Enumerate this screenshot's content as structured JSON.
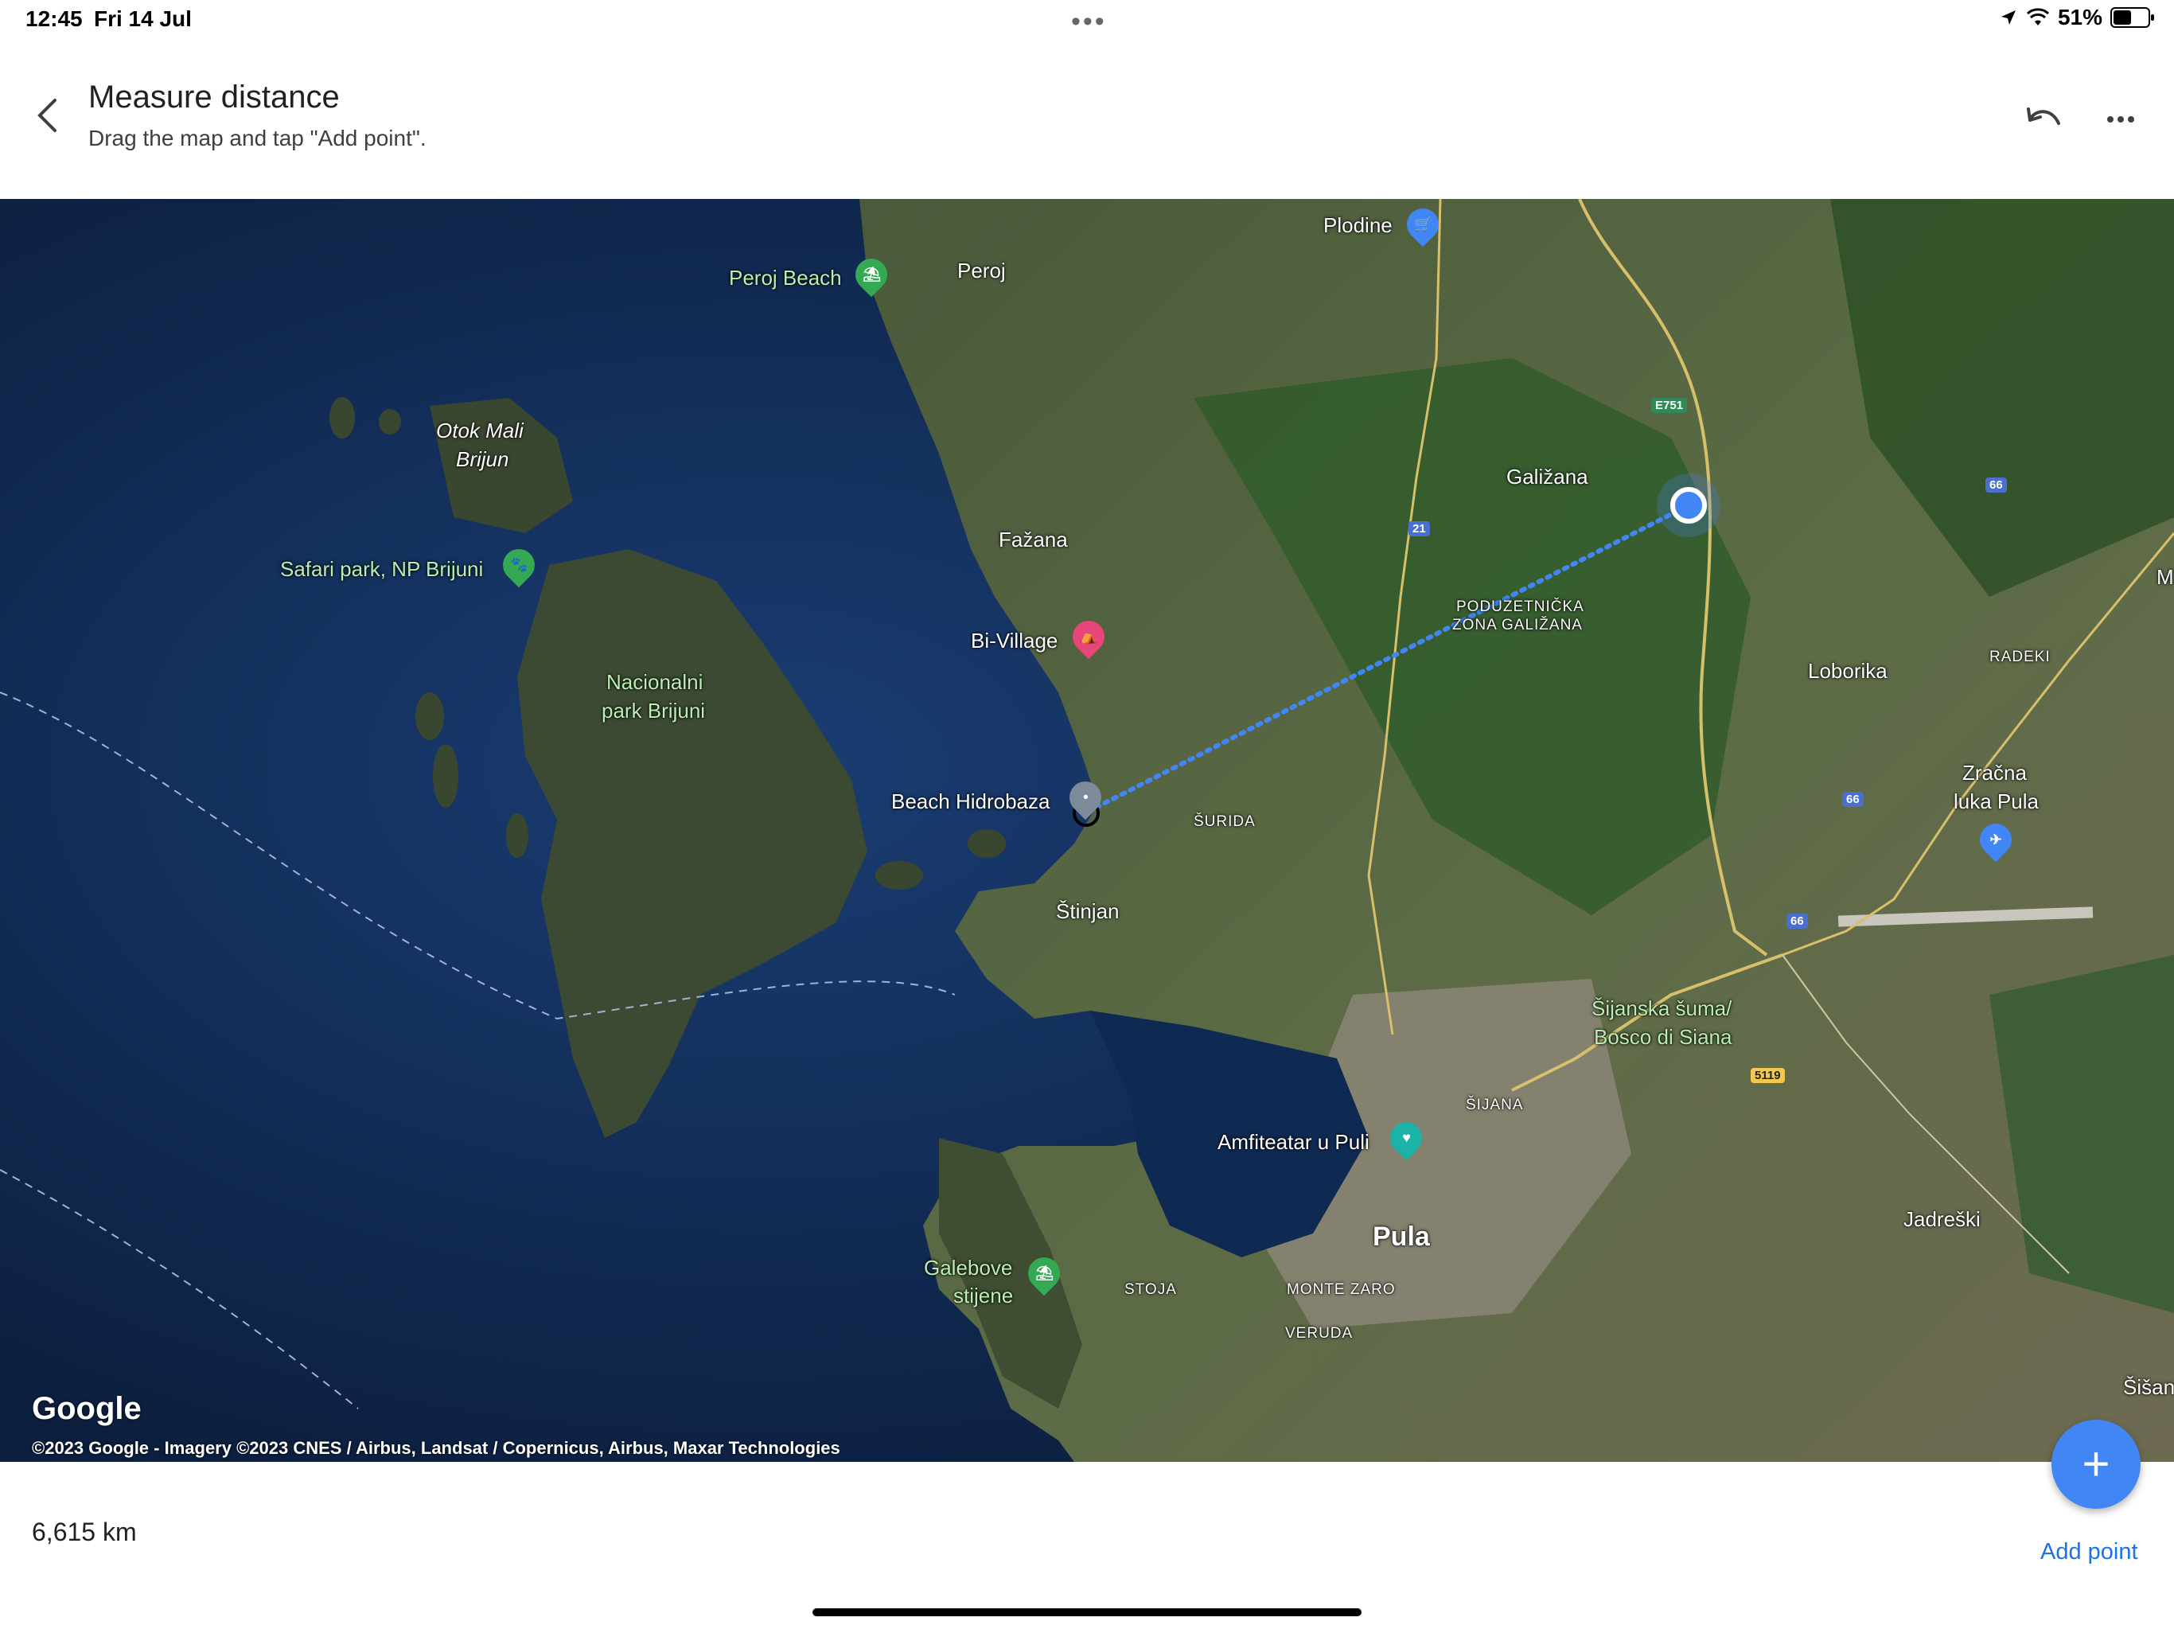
{
  "status_bar": {
    "time": "12:45",
    "date": "Fri 14 Jul",
    "battery": "51%"
  },
  "header": {
    "title": "Measure distance",
    "subtitle": "Drag the map and tap \"Add point\"."
  },
  "map": {
    "labels": {
      "plodine": "Plodine",
      "peroj": "Peroj",
      "peroj_beach": "Peroj Beach",
      "galizana": "Galižana",
      "otok_1": "Otok Mali",
      "otok_2": "Brijun",
      "fazana": "Fažana",
      "safari": "Safari park, NP Brijuni",
      "poduzet_1": "PODUZETNIČKA",
      "poduzet_2": "ZONA GALIŽANA",
      "bivillage": "Bi-Village",
      "loborika": "Loborika",
      "radeki": "RADEKI",
      "nacionalni_1": "Nacionalni",
      "nacionalni_2": "park Brijuni",
      "zracna_1": "Zračna",
      "zracna_2": "luka Pula",
      "hidrobaza": "Beach Hidrobaza",
      "surida": "ŠURIDA",
      "stinjan": "Štinjan",
      "sijanska_1": "Šijanska šuma/",
      "sijanska_2": "Bosco di Siana",
      "sijana": "ŠIJANA",
      "amfiteatar": "Amfiteatar u Puli",
      "pula": "Pula",
      "jadreski": "Jadreški",
      "galebove_1": "Galebove",
      "galebove_2": "stijene",
      "stoja": "STOJA",
      "monte_zaro": "MONTE ZARO",
      "veruda": "VERUDA",
      "sisan": "Šišan",
      "m_edge": "M"
    },
    "shields": {
      "e751": "E751",
      "r21": "21",
      "r66a": "66",
      "r66b": "66",
      "r66c": "66",
      "r5119": "5119"
    },
    "google_logo": "Google",
    "copyright": "©2023 Google - Imagery ©2023 CNES / Airbus, Landsat / Copernicus, Airbus, Maxar Technologies",
    "line_color": "#4285f4"
  },
  "footer": {
    "distance": "6,615 km",
    "add_point_label": "Add point",
    "fab_symbol": "+"
  }
}
